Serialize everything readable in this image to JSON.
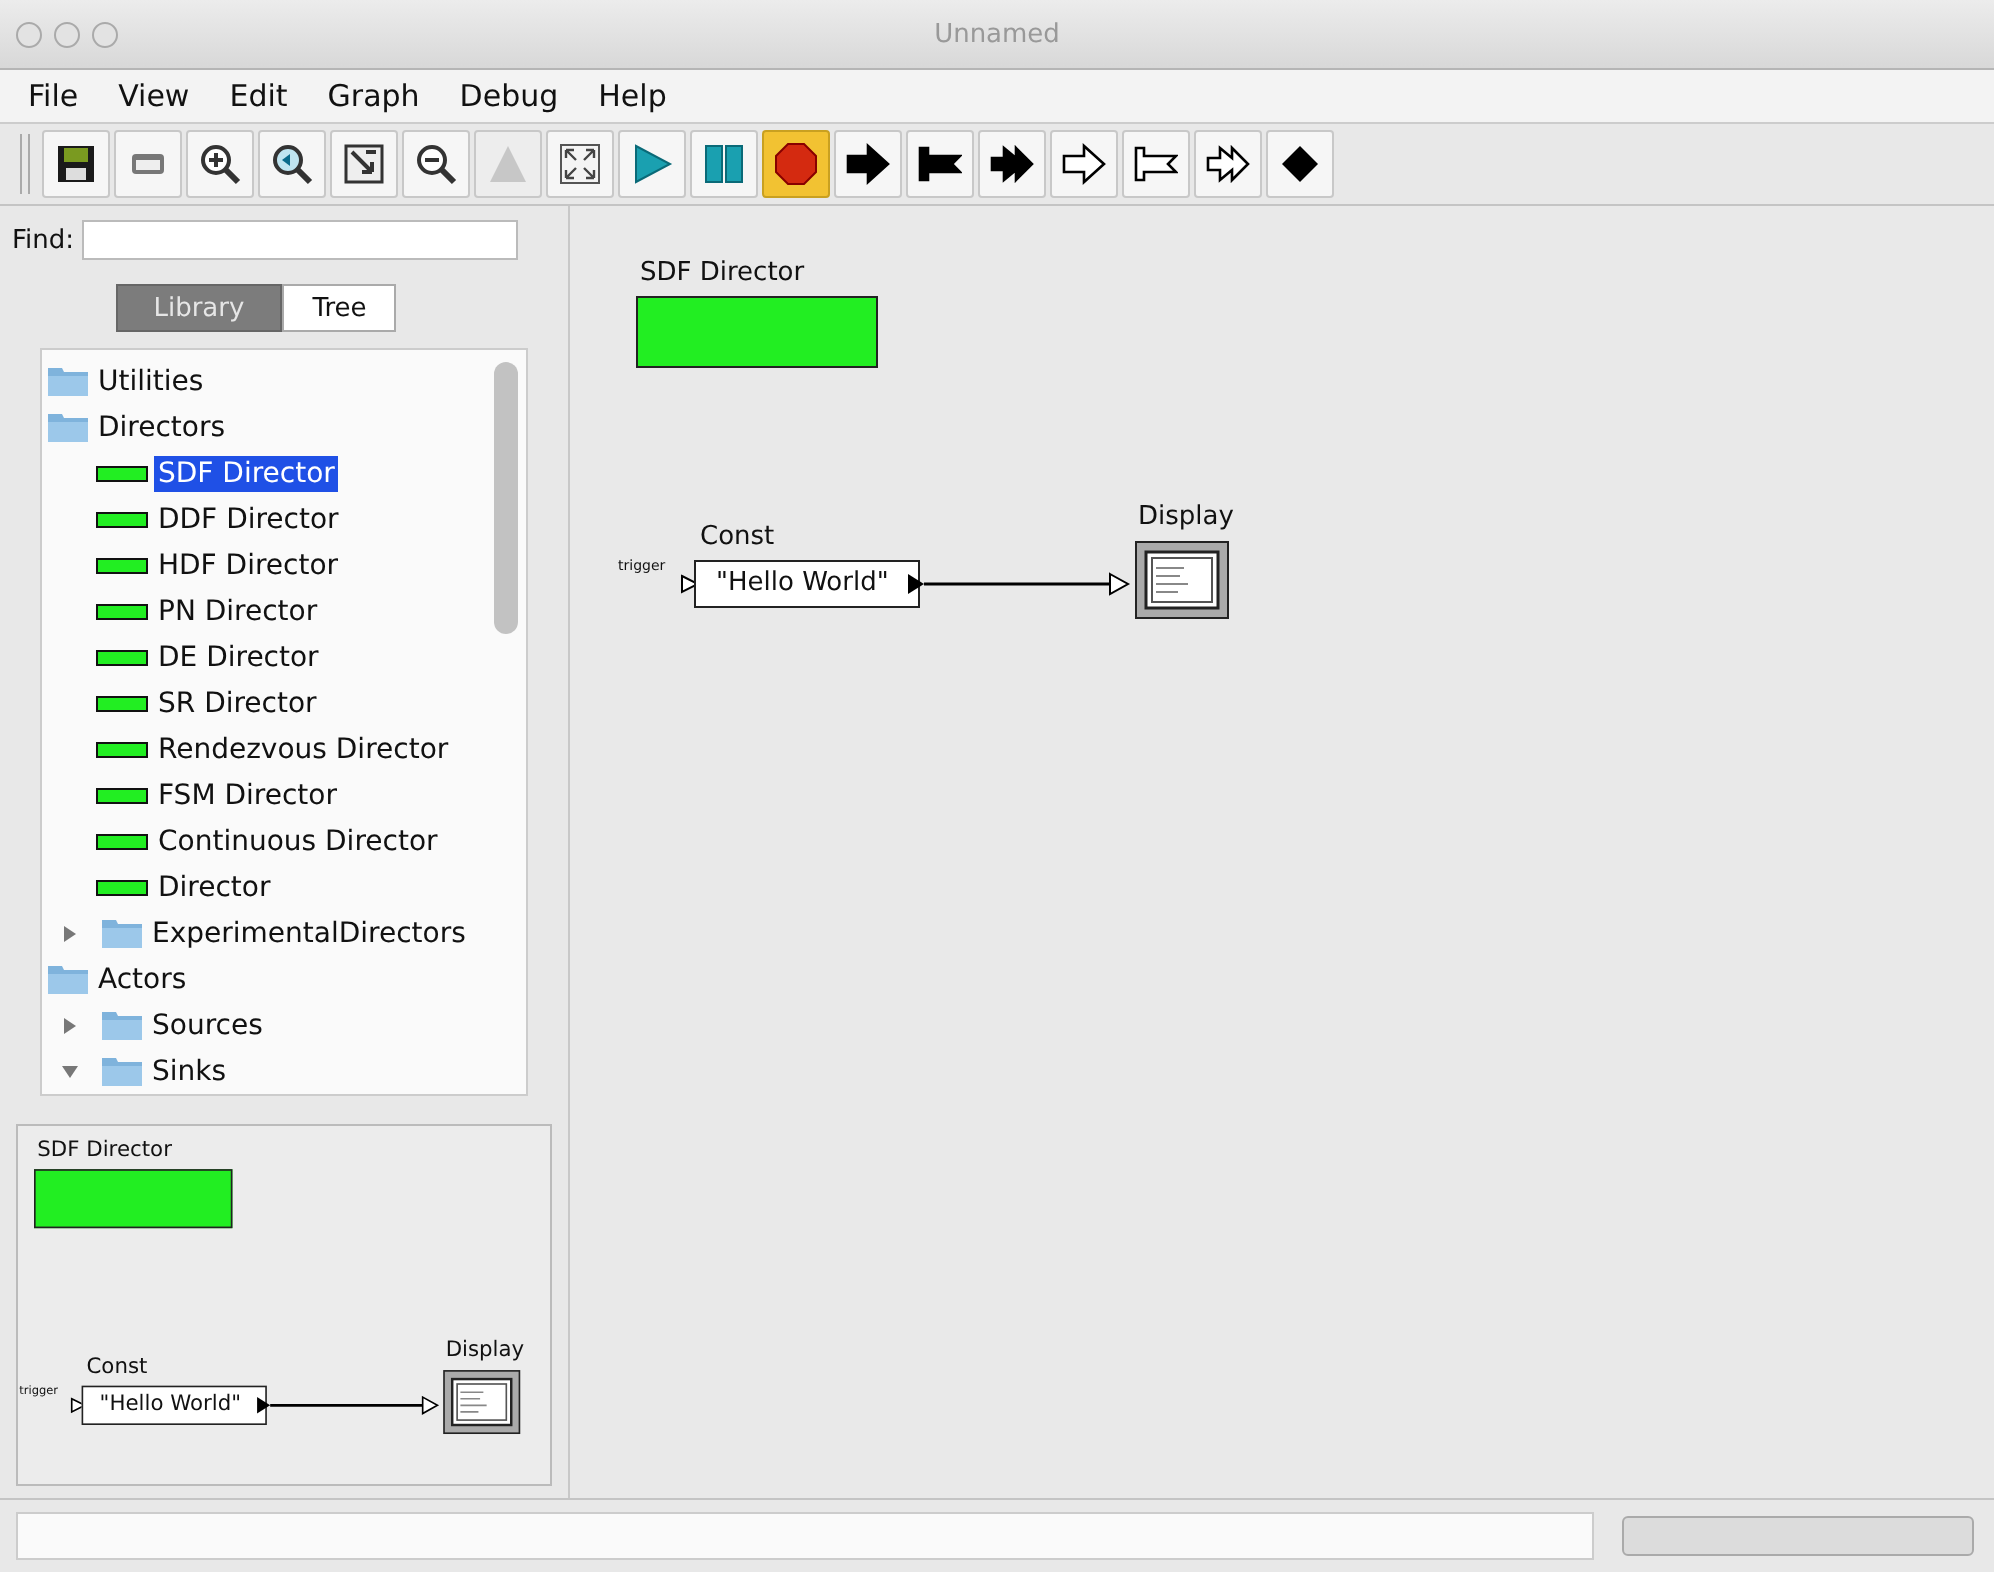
{
  "window": {
    "title": "Unnamed"
  },
  "menu": [
    "File",
    "View",
    "Edit",
    "Graph",
    "Debug",
    "Help"
  ],
  "toolbar": [
    {
      "kind": "save",
      "active": false,
      "disabled": false
    },
    {
      "kind": "print",
      "active": false,
      "disabled": false
    },
    {
      "kind": "zoom-in",
      "active": false,
      "disabled": false
    },
    {
      "kind": "zoom-reset",
      "active": false,
      "disabled": false
    },
    {
      "kind": "zoom-fit",
      "active": false,
      "disabled": false
    },
    {
      "kind": "zoom-out",
      "active": false,
      "disabled": false
    },
    {
      "kind": "up",
      "active": false,
      "disabled": true
    },
    {
      "kind": "fullscreen",
      "active": false,
      "disabled": false
    },
    {
      "kind": "run",
      "active": false,
      "disabled": false
    },
    {
      "kind": "pause",
      "active": false,
      "disabled": false
    },
    {
      "kind": "stop",
      "active": true,
      "disabled": false
    },
    {
      "kind": "arrow",
      "active": false,
      "disabled": false
    },
    {
      "kind": "flag-arrow",
      "active": false,
      "disabled": false
    },
    {
      "kind": "cross-arrow",
      "active": false,
      "disabled": false
    },
    {
      "kind": "hollow-arrow",
      "active": false,
      "disabled": false
    },
    {
      "kind": "hollow-flag-arrow",
      "active": false,
      "disabled": false
    },
    {
      "kind": "hollow-cross-arrow",
      "active": false,
      "disabled": false
    },
    {
      "kind": "diamond",
      "active": false,
      "disabled": false
    }
  ],
  "find": {
    "label": "Find:"
  },
  "library_tabs": [
    {
      "label": "Library",
      "selected": true
    },
    {
      "label": "Tree",
      "selected": false
    }
  ],
  "tree": [
    {
      "kind": "category",
      "label": "Utilities",
      "selected": false
    },
    {
      "kind": "category",
      "label": "Directors",
      "selected": false,
      "children": [
        {
          "kind": "director",
          "label": "SDF Director",
          "selected": true
        },
        {
          "kind": "director",
          "label": "DDF Director",
          "selected": false
        },
        {
          "kind": "director",
          "label": "HDF Director",
          "selected": false
        },
        {
          "kind": "director",
          "label": "PN Director",
          "selected": false
        },
        {
          "kind": "director",
          "label": "DE Director",
          "selected": false
        },
        {
          "kind": "director",
          "label": "SR Director",
          "selected": false
        },
        {
          "kind": "director",
          "label": "Rendezvous Director",
          "selected": false
        },
        {
          "kind": "director",
          "label": "FSM Director",
          "selected": false
        },
        {
          "kind": "director",
          "label": "Continuous Director",
          "selected": false
        },
        {
          "kind": "director",
          "label": "Director",
          "selected": false
        },
        {
          "kind": "folder",
          "label": "ExperimentalDirectors",
          "selected": false,
          "expanded": false
        }
      ]
    },
    {
      "kind": "category",
      "label": "Actors",
      "selected": false,
      "children": [
        {
          "kind": "folder",
          "label": "Sources",
          "selected": false,
          "expanded": false
        },
        {
          "kind": "folder",
          "label": "Sinks",
          "selected": false,
          "expanded": true
        }
      ]
    }
  ],
  "canvas": {
    "director": "SDF Director",
    "const": {
      "name": "Const",
      "value": "\"Hello World\"",
      "port": "trigger"
    },
    "display": {
      "name": "Display"
    }
  },
  "overview": {
    "director": "SDF Director",
    "const": {
      "name": "Const",
      "value": "\"Hello World\"",
      "port": "trigger"
    },
    "display": {
      "name": "Display"
    }
  },
  "status_bar": {
    "progress": {
      "level": 0
    }
  }
}
